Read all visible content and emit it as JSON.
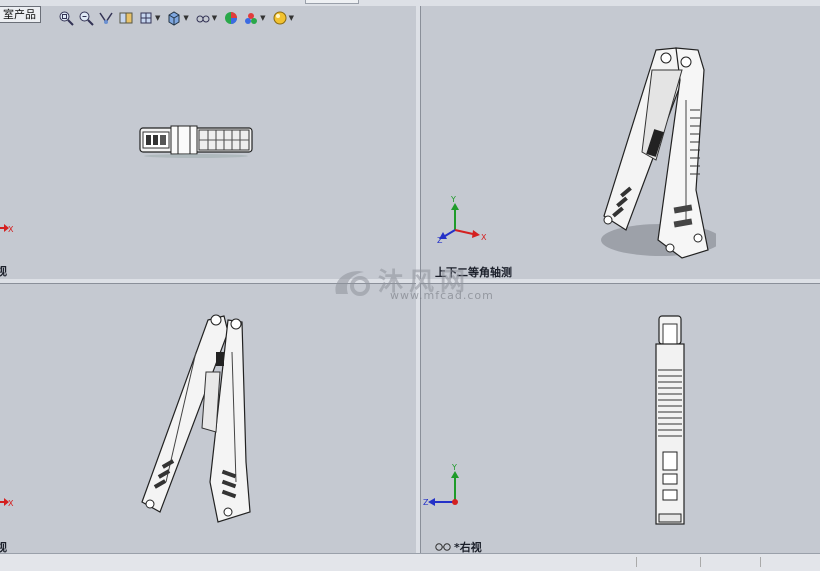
{
  "product_tab": {
    "label": "室产品"
  },
  "toolbar": {
    "tools": [
      {
        "name": "zoom-to-fit-icon"
      },
      {
        "name": "zoom-to-area-icon"
      },
      {
        "name": "previous-view-icon"
      },
      {
        "name": "section-view-icon"
      },
      {
        "name": "view-orientation-icon",
        "dropdown": true
      },
      {
        "name": "display-style-icon",
        "dropdown": true
      },
      {
        "name": "hide-show-items-icon",
        "dropdown": true
      },
      {
        "name": "edit-appearance-icon"
      },
      {
        "name": "apply-scene-icon",
        "dropdown": true
      },
      {
        "name": "view-settings-icon",
        "dropdown": true
      }
    ]
  },
  "viewports": {
    "top_left": {
      "label": "视"
    },
    "top_right": {
      "label": "上下二等角轴测"
    },
    "bottom_left": {
      "label": "视"
    },
    "bottom_right": {
      "label": "*右视"
    }
  },
  "triad_axes": {
    "x": "X",
    "y": "Y",
    "z": "Z"
  },
  "watermark": {
    "text": "沐风网",
    "url": "www.mfcad.com"
  },
  "colors": {
    "viewport_bg": "#c5c9d1",
    "axis_x": "#d42020",
    "axis_y": "#1f9b2a",
    "axis_z": "#2431c8"
  }
}
